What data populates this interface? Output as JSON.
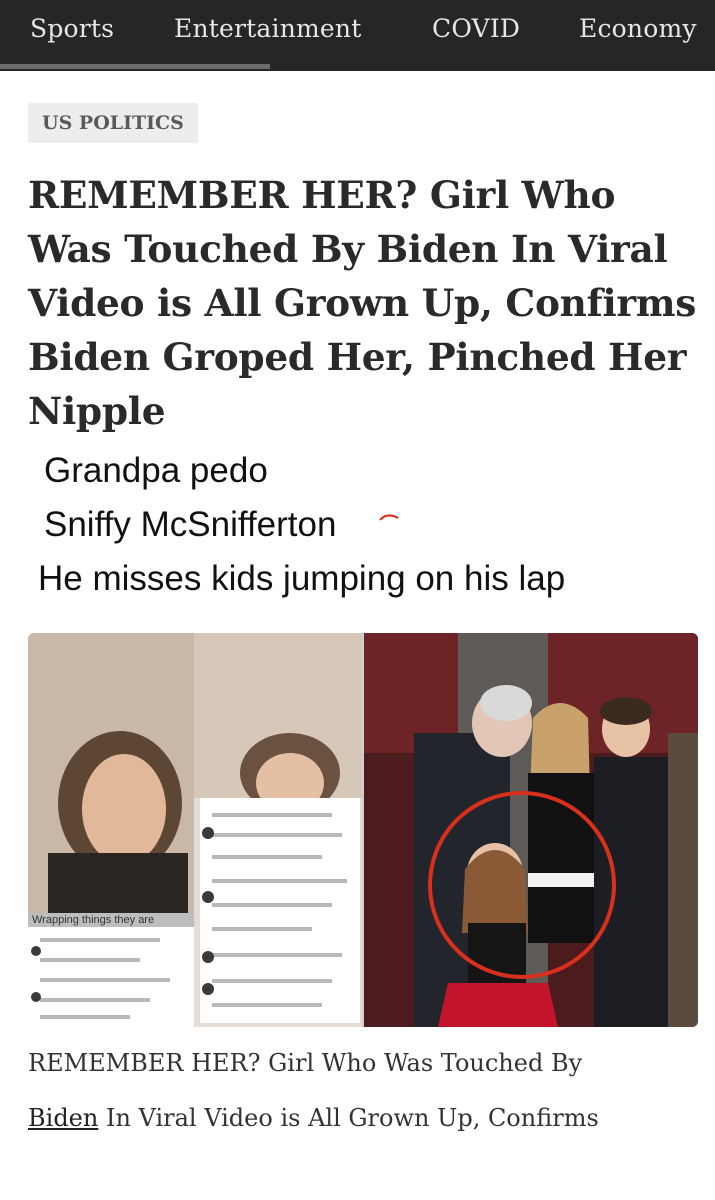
{
  "nav": {
    "tabs": [
      {
        "label": "Sports"
      },
      {
        "label": "Entertainment"
      },
      {
        "label": "COVID"
      },
      {
        "label": "Economy"
      }
    ]
  },
  "article": {
    "category": "US POLITICS",
    "headline": "REMEMBER HER? Girl Who Was Touched By Biden In Viral Video is All Grown Up, Confirms Biden Groped Her, Pinched Her Nipple",
    "caption_part1": "REMEMBER HER? Girl Who Was Touched By ",
    "caption_link": "Biden",
    "caption_part2": " In Viral Video is All Grown Up, Confirms"
  },
  "overlay_text": {
    "line1": "Grandpa pedo",
    "line2": "Sniffy McSnifferton",
    "line3": "He misses kids jumping on his lap"
  },
  "image": {
    "overlay_caption": "Wrapping things they are"
  },
  "colors": {
    "navbar_bg": "#262626",
    "badge_bg": "#ededed",
    "headline_text": "#2a2a2a",
    "circle": "#d8301c"
  }
}
